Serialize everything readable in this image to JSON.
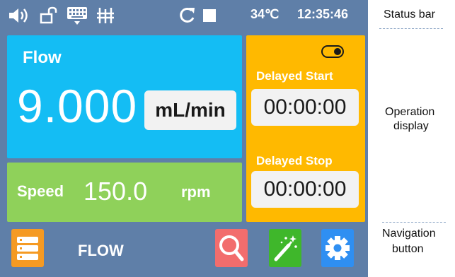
{
  "status_bar": {
    "temperature": "34℃",
    "time": "12:35:46",
    "icons": [
      "speaker-icon",
      "unlock-icon",
      "keyboard-icon",
      "filter-icon",
      "refresh-icon",
      "stop-icon"
    ]
  },
  "flow": {
    "label": "Flow",
    "value": "9.000",
    "unit": "mL/min"
  },
  "speed": {
    "label": "Speed",
    "value": "150.0",
    "unit": "rpm"
  },
  "delay": {
    "start_label": "Delayed Start",
    "start_time": "00:00:00",
    "stop_label": "Delayed Stop",
    "stop_time": "00:00:00"
  },
  "nav": {
    "title": "FLOW",
    "buttons": [
      "menu-icon",
      "search-icon",
      "magic-wand-icon",
      "gear-icon"
    ]
  },
  "annotations": {
    "status_bar": "Status bar",
    "operation_display_line1": "Operation",
    "operation_display_line2": "display",
    "navigation_line1": "Navigation",
    "navigation_line2": "button"
  },
  "colors": {
    "background": "#5f7fa8",
    "flow_panel": "#14bdf4",
    "speed_panel": "#8fd15a",
    "delay_panel": "#ffb900",
    "menu_button": "#f59a23",
    "search_button": "#f26d6d",
    "wand_button": "#3fb72b",
    "gear_button": "#2f8ff2"
  }
}
